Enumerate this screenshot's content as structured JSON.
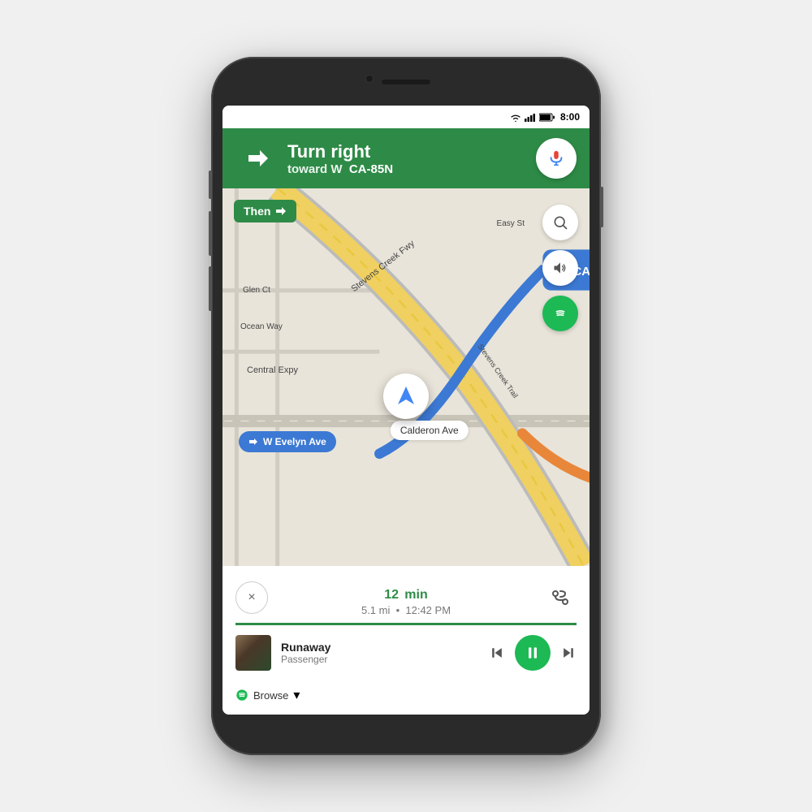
{
  "phone": {
    "statusBar": {
      "time": "8:00",
      "wifi": "wifi",
      "signal": "signal",
      "battery": "battery"
    },
    "navHeader": {
      "instruction": "Turn right",
      "toward": "toward W",
      "street": "CA-85N",
      "micIcon": "mic-icon"
    },
    "map": {
      "thenLabel": "Then",
      "thenArrow": "↱",
      "labels": [
        {
          "text": "Stevens Creek Fwy",
          "rotate": true
        },
        {
          "text": "Easy St",
          "rotate": false
        },
        {
          "text": "Glen Ct",
          "rotate": false
        },
        {
          "text": "Ocean Way",
          "rotate": false
        },
        {
          "text": "Central Expy",
          "rotate": false
        },
        {
          "text": "Stevens Creek Trail",
          "rotate": true
        }
      ],
      "directionBadge": {
        "street": "W Evelyn Ave",
        "arrow": "↱"
      },
      "rightBadge": "↱ CA",
      "calderonLabel": "Calderon Ave",
      "sideButtons": [
        {
          "icon": "search",
          "label": "search-button"
        },
        {
          "icon": "volume",
          "label": "volume-button"
        },
        {
          "icon": "spotify",
          "label": "spotify-button"
        }
      ]
    },
    "tripInfo": {
      "closeLabel": "×",
      "timeValue": "12",
      "timeUnit": "min",
      "distance": "5.1 mi",
      "eta": "12:42 PM",
      "routeIcon": "route-options-icon"
    },
    "musicPlayer": {
      "trackName": "Runaway",
      "artist": "Passenger",
      "prevIcon": "previous-icon",
      "playPauseIcon": "pause-icon",
      "nextIcon": "next-icon"
    },
    "spotifyBrowse": {
      "label": "Browse",
      "chevron": "▾"
    }
  }
}
